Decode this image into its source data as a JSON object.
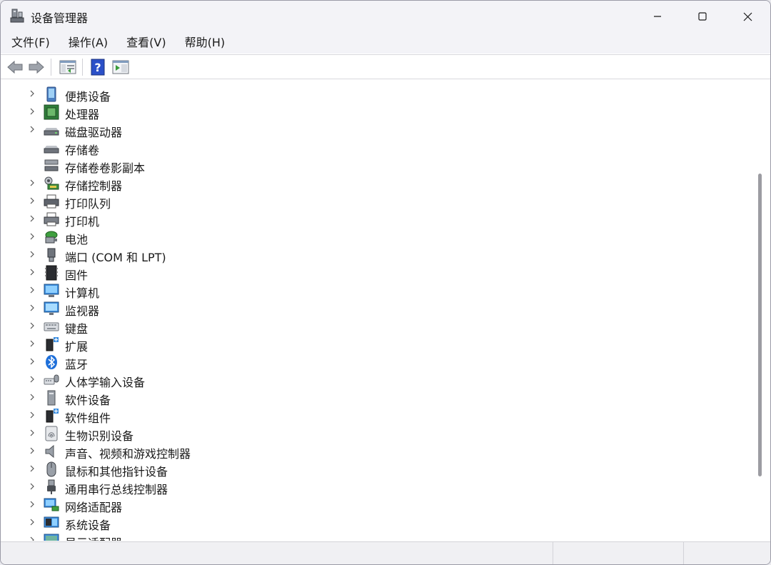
{
  "window": {
    "title": "设备管理器",
    "icon": "device-manager-icon",
    "controls": [
      "minimize-icon",
      "maximize-icon",
      "close-icon"
    ]
  },
  "menu": {
    "items": [
      {
        "label": "文件(F)"
      },
      {
        "label": "操作(A)"
      },
      {
        "label": "查看(V)"
      },
      {
        "label": "帮助(H)"
      }
    ]
  },
  "toolbar": {
    "buttons": [
      "back-arrow-icon",
      "forward-arrow-icon",
      "properties-icon",
      "help-icon",
      "run-icon"
    ]
  },
  "tree": {
    "items": [
      {
        "label": "便携设备",
        "icon": "portable-device-icon",
        "expandable": true
      },
      {
        "label": "处理器",
        "icon": "processor-icon",
        "expandable": true
      },
      {
        "label": "磁盘驱动器",
        "icon": "disk-drive-icon",
        "expandable": true
      },
      {
        "label": "存储卷",
        "icon": "storage-volume-icon",
        "expandable": false
      },
      {
        "label": "存储卷卷影副本",
        "icon": "volume-shadow-icon",
        "expandable": false
      },
      {
        "label": "存储控制器",
        "icon": "storage-controller-icon",
        "expandable": true
      },
      {
        "label": "打印队列",
        "icon": "print-queue-icon",
        "expandable": true
      },
      {
        "label": "打印机",
        "icon": "printer-icon",
        "expandable": true
      },
      {
        "label": "电池",
        "icon": "battery-icon",
        "expandable": true
      },
      {
        "label": "端口 (COM 和 LPT)",
        "icon": "port-icon",
        "expandable": true
      },
      {
        "label": "固件",
        "icon": "firmware-icon",
        "expandable": true
      },
      {
        "label": "计算机",
        "icon": "computer-icon",
        "expandable": true
      },
      {
        "label": "监视器",
        "icon": "monitor-icon",
        "expandable": true
      },
      {
        "label": "键盘",
        "icon": "keyboard-icon",
        "expandable": true
      },
      {
        "label": "扩展",
        "icon": "extension-icon",
        "expandable": true
      },
      {
        "label": "蓝牙",
        "icon": "bluetooth-icon",
        "expandable": true
      },
      {
        "label": "人体学输入设备",
        "icon": "hid-icon",
        "expandable": true
      },
      {
        "label": "软件设备",
        "icon": "software-device-icon",
        "expandable": true
      },
      {
        "label": "软件组件",
        "icon": "software-component-icon",
        "expandable": true
      },
      {
        "label": "生物识别设备",
        "icon": "fingerprint-icon",
        "expandable": true
      },
      {
        "label": "声音、视频和游戏控制器",
        "icon": "speaker-icon",
        "expandable": true
      },
      {
        "label": "鼠标和其他指针设备",
        "icon": "mouse-icon",
        "expandable": true
      },
      {
        "label": "通用串行总线控制器",
        "icon": "usb-icon",
        "expandable": true
      },
      {
        "label": "网络适配器",
        "icon": "network-adapter-icon",
        "expandable": true
      },
      {
        "label": "系统设备",
        "icon": "system-device-icon",
        "expandable": true
      },
      {
        "label": "显示适配器",
        "icon": "display-adapter-icon",
        "expandable": true
      }
    ]
  },
  "colors": {
    "accent": "#1e6fd9",
    "chrome": "#f3f3f7",
    "text": "#1a1a1a"
  }
}
